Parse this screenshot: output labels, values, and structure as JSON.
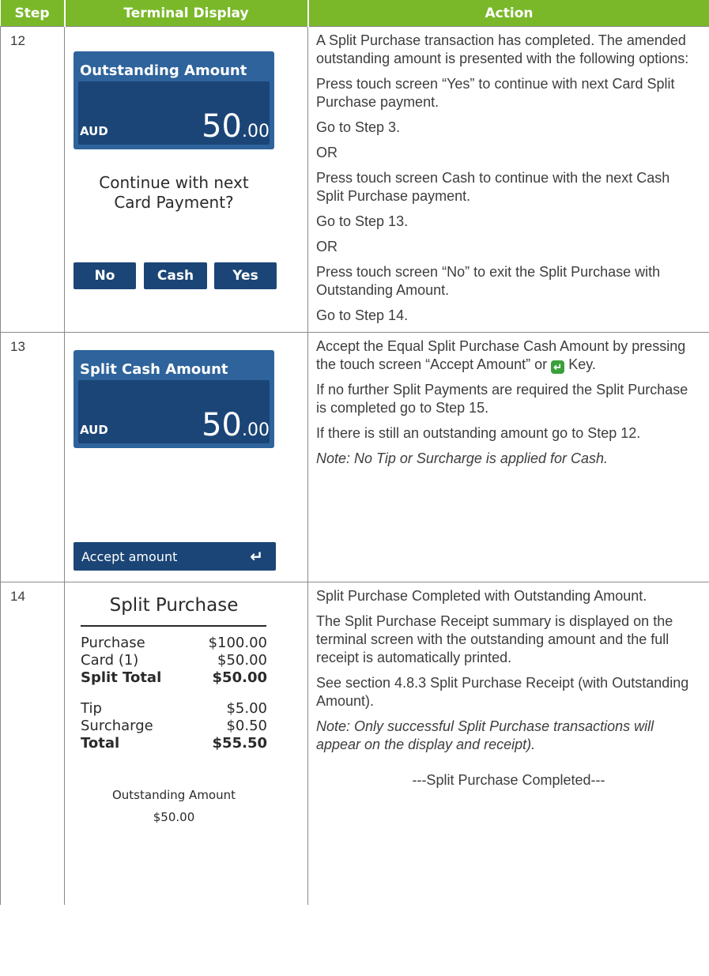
{
  "header": {
    "step": "Step",
    "display": "Terminal Display",
    "action": "Action"
  },
  "rows": [
    {
      "step": "12",
      "panel": {
        "title": "Outstanding Amount",
        "currency": "AUD",
        "amount_main": "50",
        "amount_cents": ".00"
      },
      "prompt": [
        "Continue with next",
        "Card Payment?"
      ],
      "buttons": [
        "No",
        "Cash",
        "Yes"
      ],
      "actions": [
        "A Split Purchase transaction has completed. The amended outstanding amount is presented with the following options:",
        "Press touch screen “Yes” to continue with next Card Split Purchase payment.",
        "Go to Step 3.",
        "OR",
        "Press touch screen Cash to continue with the next Cash Split Purchase payment.",
        "Go to Step 13.",
        "OR",
        "Press touch screen “No” to exit the Split Purchase with Outstanding Amount.",
        "Go to Step 14."
      ]
    },
    {
      "step": "13",
      "panel": {
        "title": "Split Cash Amount",
        "currency": "AUD",
        "amount_main": "50",
        "amount_cents": ".00"
      },
      "accept_label": "Accept amount",
      "accept_icon": "return-key-icon",
      "actions": {
        "p1_before": "Accept the Equal Split Purchase Cash Amount by pressing the touch screen “Accept Amount” or",
        "p1_after": "Key.",
        "p2": "If no further Split Payments are required the Split Purchase is completed go to Step 15.",
        "p3": "If there is still an outstanding amount go to Step 12.",
        "note": "Note: No Tip or Surcharge is applied for Cash."
      }
    },
    {
      "step": "14",
      "receipt": {
        "title": "Split Purchase",
        "lines": [
          {
            "label": "Purchase",
            "value": "$100.00"
          },
          {
            "label": "Card (1)",
            "value": "$50.00"
          },
          {
            "label": "Split Total",
            "value": "$50.00"
          },
          {
            "label": "Tip",
            "value": "$5.00"
          },
          {
            "label": "Surcharge",
            "value": "$0.50"
          },
          {
            "label": "Total",
            "value": "$55.50"
          }
        ],
        "outstanding_label": "Outstanding Amount",
        "outstanding_value": "$50.00"
      },
      "actions": {
        "p1": "Split Purchase Completed with Outstanding Amount.",
        "p2": "The Split Purchase Receipt summary is displayed on the terminal screen with the outstanding amount and the full receipt is automatically printed.",
        "p3": "See section 4.8.3 Split Purchase Receipt (with Outstanding Amount).",
        "note": "Note: Only successful Split Purchase transactions will appear on the display and receipt).",
        "footer": "---Split Purchase Completed---"
      }
    }
  ],
  "colors": {
    "header_green": "#7ab829",
    "panel_blue": "#2e639c",
    "panel_dark": "#1b4576"
  }
}
